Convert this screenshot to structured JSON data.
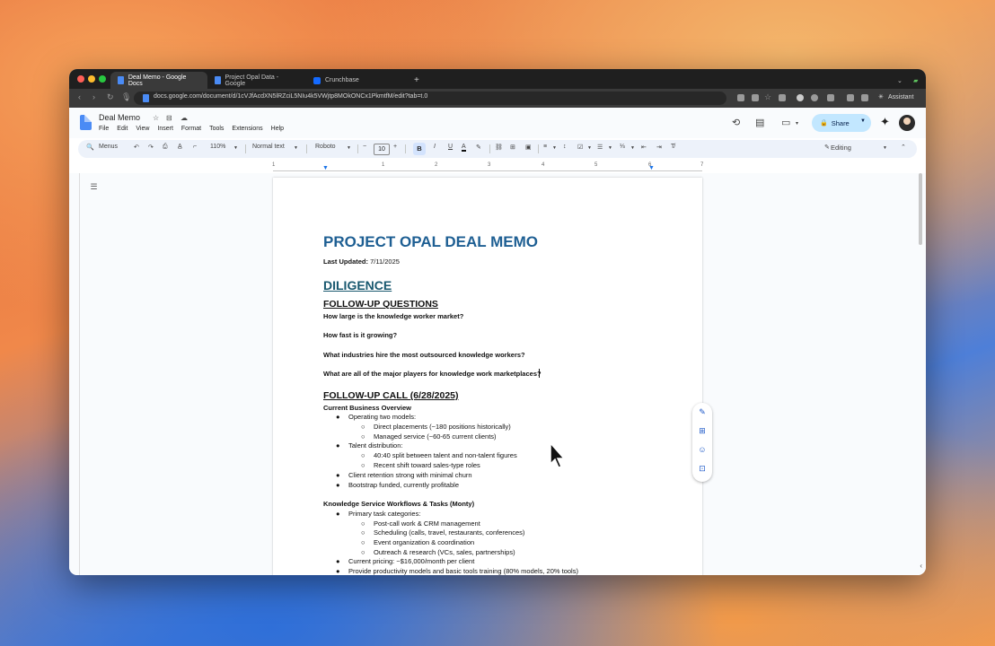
{
  "browser": {
    "tabs": [
      {
        "label": "Deal Memo - Google Docs",
        "active": true
      },
      {
        "label": "Project Opal Data - Google",
        "active": false
      },
      {
        "label": "Crunchbase",
        "active": false
      }
    ],
    "new_tab_label": "+",
    "url": "docs.google.com/document/d/1cVJfAcdXN5lRZciL5NIu4k5VWjtp8MOkONCx1PkmtfM/edit?tab=t.0",
    "assistant_label": "Assistant"
  },
  "docs": {
    "title": "Deal Memo",
    "menu": [
      "File",
      "Edit",
      "View",
      "Insert",
      "Format",
      "Tools",
      "Extensions",
      "Help"
    ],
    "share_label": "Share"
  },
  "toolbar": {
    "menus_label": "Menus",
    "zoom": "110%",
    "style": "Normal text",
    "font": "Roboto",
    "font_size": "10",
    "minus": "−",
    "plus": "+",
    "bold": "B",
    "italic": "I",
    "underline": "U",
    "text_color": "A",
    "editing_label": "Editing"
  },
  "ruler": [
    "1",
    "1",
    "2",
    "3",
    "4",
    "5",
    "6",
    "7"
  ],
  "document": {
    "title": "PROJECT OPAL DEAL MEMO",
    "last_updated_label": "Last Updated:",
    "last_updated_value": "7/11/2025",
    "diligence": "DILIGENCE",
    "followup_questions": "FOLLOW-UP QUESTIONS",
    "questions": [
      "How large is the knowledge worker market?",
      "How fast is it growing?",
      "What industries hire the most outsourced knowledge workers?",
      "What are all of the major players for knowledge work marketplaces?"
    ],
    "followup_call": "FOLLOW-UP CALL (6/28/2025)",
    "current_overview": "Current Business Overview",
    "overview": {
      "models": "Operating two models:",
      "direct": "Direct placements (~180 positions historically)",
      "managed": "Managed service (~60-65 current clients)",
      "talent": "Talent distribution:",
      "split": "40:40 split between talent and non-talent figures",
      "shift": "Recent shift toward sales-type roles",
      "retention": "Client retention strong with minimal churn",
      "bootstrap": "Bootstrap funded, currently profitable"
    },
    "workflows_heading": "Knowledge Service Workflows & Tasks (Monty)",
    "workflows": {
      "primary": "Primary task categories:",
      "postcall": "Post-call work & CRM management",
      "scheduling": "Scheduling (calls, travel, restaurants, conferences)",
      "events": "Event organization & coordination",
      "outreach": "Outreach & research (VCs, sales, partnerships)",
      "pricing": "Current pricing: ~$16,000/month per client",
      "training": "Provide productivity models and basic tools training (80% models, 20% tools)"
    },
    "bullet_char": "●",
    "sub_bullet_char": "○"
  }
}
